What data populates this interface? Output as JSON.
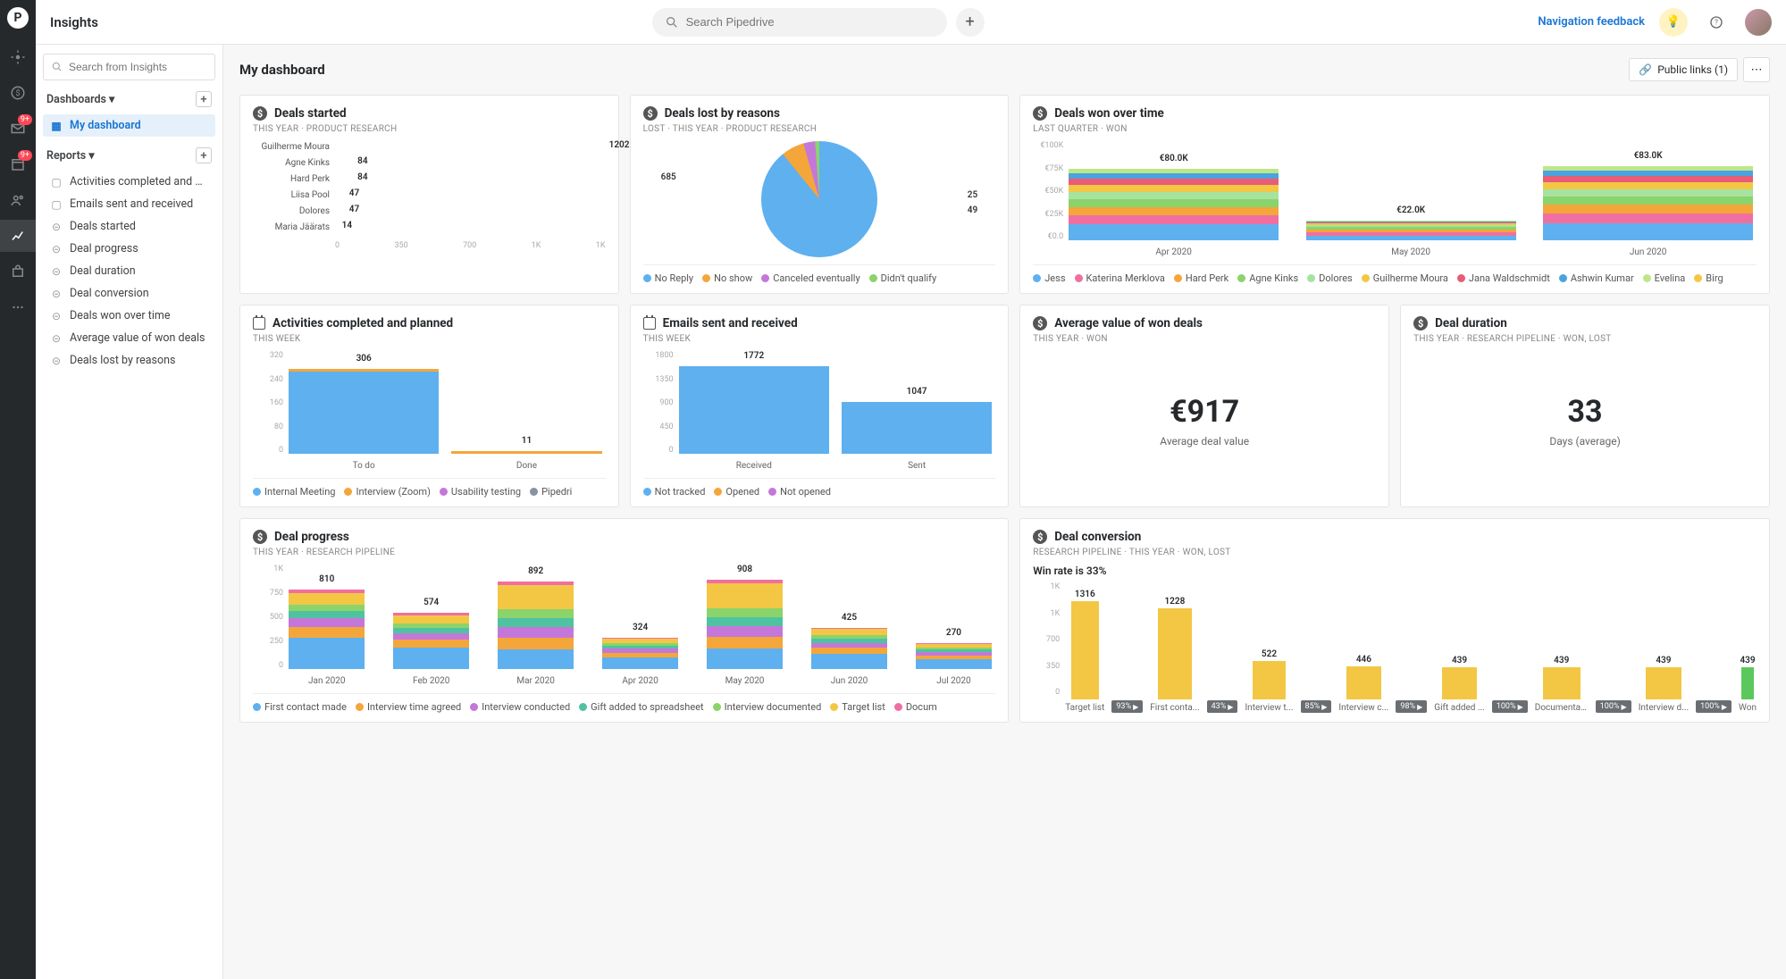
{
  "app": {
    "title": "Insights"
  },
  "search": {
    "placeholder": "Search Pipedrive"
  },
  "topbar": {
    "nav_feedback": "Navigation feedback",
    "publinks": "Public links (1)"
  },
  "sidebar": {
    "search_placeholder": "Search from Insights",
    "dashboards_label": "Dashboards",
    "reports_label": "Reports",
    "dashboards": [
      {
        "label": "My dashboard",
        "active": true
      }
    ],
    "reports": [
      {
        "label": "Activities completed and …",
        "icon": "cal"
      },
      {
        "label": "Emails sent and received",
        "icon": "cal"
      },
      {
        "label": "Deals started",
        "icon": "dollar"
      },
      {
        "label": "Deal progress",
        "icon": "dollar"
      },
      {
        "label": "Deal duration",
        "icon": "dollar"
      },
      {
        "label": "Deal conversion",
        "icon": "dollar"
      },
      {
        "label": "Deals won over time",
        "icon": "dollar"
      },
      {
        "label": "Average value of won deals",
        "icon": "dollar"
      },
      {
        "label": "Deals lost by reasons",
        "icon": "dollar"
      }
    ]
  },
  "rail": {
    "mail_badge": "9+",
    "cal_badge": "9+"
  },
  "canvas": {
    "title": "My dashboard"
  },
  "cards": {
    "deals_started": {
      "title": "Deals started",
      "sub": "THIS YEAR · PRODUCT RESEARCH",
      "chart_data": {
        "type": "bar",
        "orientation": "horizontal",
        "categories": [
          "Guilherme Moura",
          "Agne Kinks",
          "Hard Perk",
          "Liisa Pool",
          "Dolores",
          "Maria Jäärats"
        ],
        "values": [
          1202,
          84,
          84,
          47,
          47,
          14
        ],
        "xticks": [
          "0",
          "350",
          "700",
          "1K",
          "1K"
        ]
      }
    },
    "deals_lost": {
      "title": "Deals lost by reasons",
      "sub": "LOST · THIS YEAR · PRODUCT RESEARCH",
      "chart_data": {
        "type": "pie",
        "slices": [
          {
            "label": "No Reply",
            "value": 685,
            "color": "#5eb0ef"
          },
          {
            "label": "No show",
            "value": 49,
            "color": "#f4a63a"
          },
          {
            "label": "Canceled eventually",
            "value": 25,
            "color": "#c477d9"
          },
          {
            "label": "Didn't qualify",
            "value": 9,
            "color": "#8bd36b"
          }
        ]
      },
      "legend": [
        "No Reply",
        "No show",
        "Canceled eventually",
        "Didn't qualify"
      ],
      "legend_colors": [
        "#5eb0ef",
        "#f4a63a",
        "#c477d9",
        "#8bd36b"
      ]
    },
    "deals_won_time": {
      "title": "Deals won over time",
      "sub": "LAST QUARTER · WON",
      "chart_data": {
        "type": "bar",
        "stacked": true,
        "yticks": [
          "€0.0",
          "€25K",
          "€50K",
          "€75K",
          "€100K"
        ],
        "ymax": 100,
        "categories": [
          "Apr 2020",
          "May 2020",
          "Jun 2020"
        ],
        "totals": [
          "€80.0K",
          "€22.0K",
          "€83.0K"
        ],
        "series_names": [
          "Jess",
          "Katerina Merklova",
          "Hard Perk",
          "Agne Kinks",
          "Dolores",
          "Guilherme Moura",
          "Jana Waldschmidt",
          "Ashwin Kumar",
          "Evelina",
          "Birg"
        ],
        "series_colors": [
          "#5eb0ef",
          "#ef6fa0",
          "#f4a63a",
          "#8bd36b",
          "#a6e3a1",
          "#f3c744",
          "#e85d75",
          "#4aa3df",
          "#bde68a",
          "#f3c744"
        ],
        "stacks": [
          [
            18,
            10,
            9,
            9,
            8,
            8,
            7,
            6,
            5
          ],
          [
            5,
            4,
            3,
            3,
            2,
            2,
            1.5,
            1,
            0.5
          ],
          [
            19,
            11,
            10,
            9,
            8,
            8,
            7,
            6,
            5
          ]
        ]
      },
      "legend": [
        "Jess",
        "Katerina Merklova",
        "Hard Perk",
        "Agne Kinks",
        "Dolores",
        "Guilherme Moura",
        "Jana Waldschmidt",
        "Ashwin Kumar",
        "Evelina",
        "Birg"
      ],
      "legend_colors": [
        "#5eb0ef",
        "#ef6fa0",
        "#f4a63a",
        "#8bd36b",
        "#a6e3a1",
        "#f3c744",
        "#e85d75",
        "#4aa3df",
        "#bde68a",
        "#f3c744"
      ]
    },
    "activities": {
      "title": "Activities completed and planned",
      "sub": "THIS WEEK",
      "chart_data": {
        "type": "bar",
        "yticks": [
          "0",
          "80",
          "160",
          "240",
          "320"
        ],
        "ymax": 320,
        "categories": [
          "To do",
          "Done"
        ],
        "values": [
          306,
          11
        ],
        "colors": [
          "#5eb0ef",
          "#5eb0ef"
        ],
        "topStripe": true
      },
      "legend": [
        "Internal Meeting",
        "Interview (Zoom)",
        "Usability testing",
        "Pipedri"
      ],
      "legend_colors": [
        "#5eb0ef",
        "#f4a63a",
        "#c477d9",
        "#8892a0"
      ]
    },
    "emails": {
      "title": "Emails sent and received",
      "sub": "THIS WEEK",
      "chart_data": {
        "type": "bar",
        "yticks": [
          "0",
          "450",
          "900",
          "1350",
          "1800"
        ],
        "ymax": 1800,
        "categories": [
          "Received",
          "Sent"
        ],
        "values": [
          1772,
          1047
        ],
        "colors": [
          "#5eb0ef",
          "#5eb0ef"
        ]
      },
      "legend": [
        "Not tracked",
        "Opened",
        "Not opened"
      ],
      "legend_colors": [
        "#5eb0ef",
        "#f4a63a",
        "#c477d9"
      ]
    },
    "avg_value": {
      "title": "Average value of won deals",
      "sub": "THIS YEAR · WON",
      "value": "€917",
      "label": "Average deal value"
    },
    "deal_duration": {
      "title": "Deal duration",
      "sub": "THIS YEAR · RESEARCH PIPELINE · WON, LOST",
      "value": "33",
      "label": "Days (average)"
    },
    "deal_progress": {
      "title": "Deal progress",
      "sub": "THIS YEAR · RESEARCH PIPELINE",
      "chart_data": {
        "type": "bar",
        "stacked": true,
        "yticks": [
          "0",
          "250",
          "500",
          "750",
          "1K"
        ],
        "ymax": 1000,
        "categories": [
          "Jan 2020",
          "Feb 2020",
          "Mar 2020",
          "Apr 2020",
          "May 2020",
          "Jun 2020",
          "Jul 2020"
        ],
        "totals": [
          "810",
          "574",
          "892",
          "324",
          "908",
          "425",
          "270"
        ],
        "series_colors": [
          "#5eb0ef",
          "#f4a63a",
          "#c477d9",
          "#4fc3a1",
          "#8bd36b",
          "#f3c744",
          "#ef6fa0"
        ],
        "stacks": [
          [
            320,
            110,
            90,
            70,
            70,
            120,
            30
          ],
          [
            220,
            80,
            70,
            50,
            50,
            80,
            24
          ],
          [
            200,
            120,
            110,
            90,
            90,
            250,
            32
          ],
          [
            120,
            50,
            40,
            30,
            30,
            40,
            14
          ],
          [
            210,
            120,
            110,
            90,
            90,
            260,
            28
          ],
          [
            160,
            60,
            50,
            40,
            40,
            60,
            15
          ],
          [
            100,
            40,
            35,
            25,
            25,
            35,
            10
          ]
        ]
      },
      "legend": [
        "First contact made",
        "Interview time agreed",
        "Interview conducted",
        "Gift added to spreadsheet",
        "Interview documented",
        "Target list",
        "Docum"
      ],
      "legend_colors": [
        "#5eb0ef",
        "#f4a63a",
        "#c477d9",
        "#4fc3a1",
        "#8bd36b",
        "#f3c744",
        "#ef6fa0"
      ]
    },
    "deal_conversion": {
      "title": "Deal conversion",
      "sub": "RESEARCH PIPELINE · THIS YEAR · WON, LOST",
      "winrate": "Win rate is 33%",
      "chart_data": {
        "type": "bar",
        "yticks": [
          "0",
          "350",
          "700",
          "1K",
          "1K"
        ],
        "ymax": 1316,
        "steps": [
          {
            "label": "Target list",
            "value": 1316,
            "conv": "93%"
          },
          {
            "label": "First conta...",
            "value": 1228,
            "conv": "43%"
          },
          {
            "label": "Interview t...",
            "value": 522,
            "conv": "85%"
          },
          {
            "label": "Interview c...",
            "value": 446,
            "conv": "98%"
          },
          {
            "label": "Gift added ...",
            "value": 439,
            "conv": "100%"
          },
          {
            "label": "Documentati...",
            "value": 439,
            "conv": "100%"
          },
          {
            "label": "Interview d...",
            "value": 439,
            "conv": "100%"
          },
          {
            "label": "Won",
            "value": 439,
            "won": true
          }
        ]
      }
    }
  }
}
